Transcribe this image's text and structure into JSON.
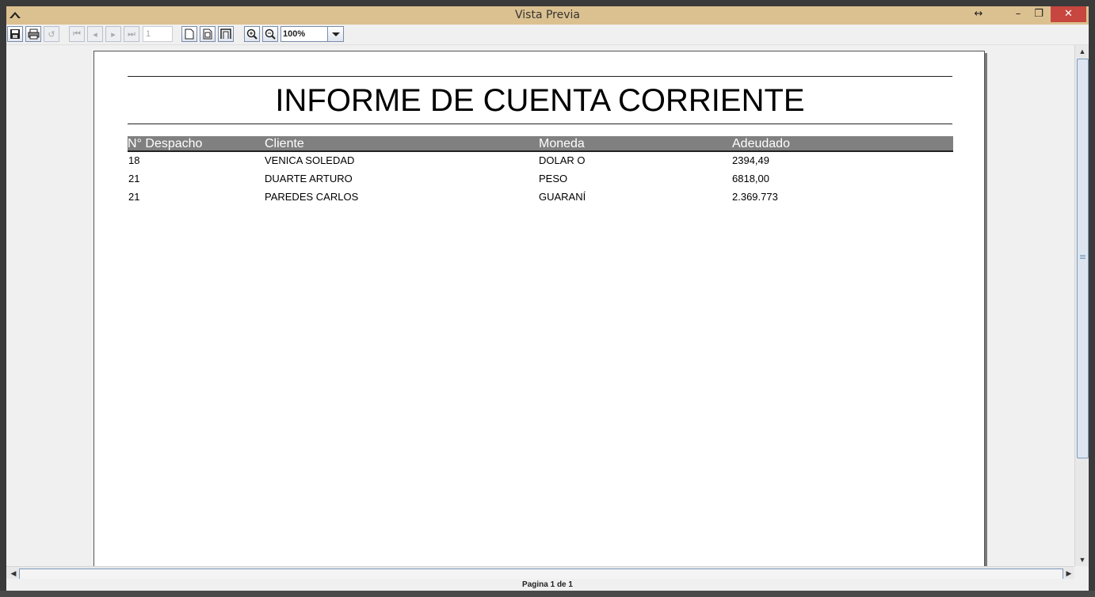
{
  "window": {
    "title": "Vista Previa"
  },
  "toolbar": {
    "page_number": "1",
    "zoom": "100%"
  },
  "report": {
    "title": "INFORME DE CUENTA CORRIENTE",
    "columns": [
      "N° Despacho",
      "Cliente",
      "Moneda",
      "Adeudado"
    ],
    "rows": [
      [
        "18",
        "VENICA SOLEDAD",
        "DOLAR O",
        "2394,49"
      ],
      [
        "21",
        "DUARTE ARTURO",
        "PESO",
        "6818,00"
      ],
      [
        "21",
        "PAREDES CARLOS",
        "GUARANÍ",
        "2.369.773"
      ]
    ]
  },
  "status": {
    "page_info": "Pagina 1 de 1"
  }
}
